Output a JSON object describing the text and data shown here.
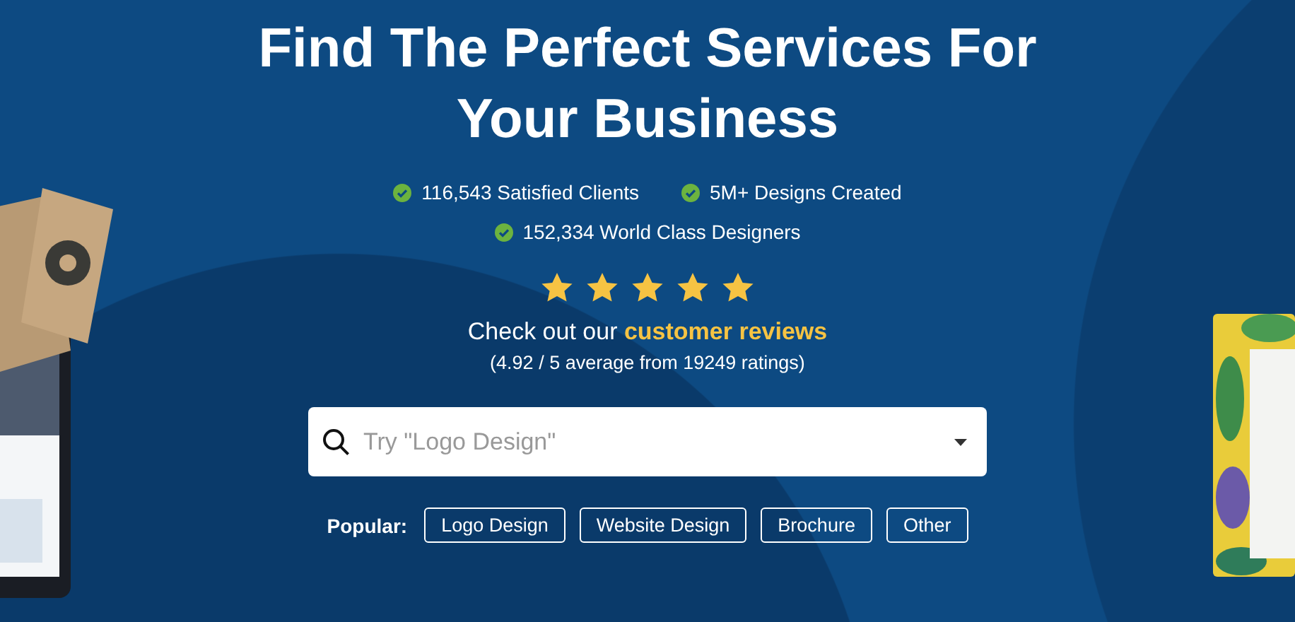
{
  "headline": "Find The Perfect Services For Your Business",
  "stats": [
    "116,543 Satisfied Clients",
    "5M+ Designs Created",
    "152,334 World Class Designers"
  ],
  "rating": {
    "stars": 5,
    "lead": "Check out our",
    "link": "customer reviews",
    "summary": "(4.92 / 5 average from 19249 ratings)"
  },
  "search": {
    "placeholder": "Try \"Logo Design\""
  },
  "popular": {
    "label": "Popular:",
    "tags": [
      "Logo Design",
      "Website Design",
      "Brochure",
      "Other"
    ]
  },
  "pictures": [
    {
      "kind": "picture"
    },
    {
      "kind": "picture"
    }
  ]
}
